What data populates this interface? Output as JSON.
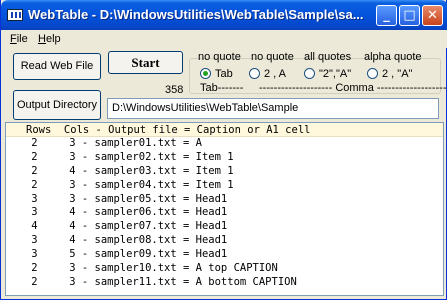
{
  "window": {
    "title": "WebTable - D:\\WindowsUtilities\\WebTable\\Sample\\sa...",
    "controls": [
      "minimize",
      "maximize",
      "close"
    ]
  },
  "menu": {
    "file": "File",
    "file_accel": "F",
    "help": "Help",
    "help_accel": "H"
  },
  "buttons": {
    "read_web_file": "Read Web File",
    "start": "Start",
    "output_directory": "Output Directory"
  },
  "count": "358",
  "quote_options": {
    "headings": [
      "no quote",
      "no quote",
      "all quotes",
      "alpha quote"
    ],
    "options": [
      {
        "label": "Tab",
        "selected": true
      },
      {
        "label": "2 , A",
        "selected": false
      },
      {
        "label": "\"2\",\"A\"",
        "selected": false
      },
      {
        "label": "2 , \"A\"",
        "selected": false
      }
    ],
    "group_tab": "Tab-------",
    "group_comma": "-------------------- Comma --------------------"
  },
  "output_directory_value": "D:\\WindowsUtilities\\WebTable\\Sample",
  "results": {
    "header": "Rows  Cols - Output file = Caption or A1 cell",
    "rows": [
      "    2     3 - sampler01.txt = A",
      "    2     3 - sampler02.txt = Item 1",
      "    2     4 - sampler03.txt = Item 1",
      "    2     3 - sampler04.txt = Item 1",
      "    3     3 - sampler05.txt = Head1",
      "    3     4 - sampler06.txt = Head1",
      "    4     4 - sampler07.txt = Head1",
      "    3     4 - sampler08.txt = Head1",
      "    3     5 - sampler09.txt = Head1",
      "    2     3 - sampler10.txt = A top CAPTION",
      "    2     3 - sampler11.txt = A bottom CAPTION"
    ]
  }
}
